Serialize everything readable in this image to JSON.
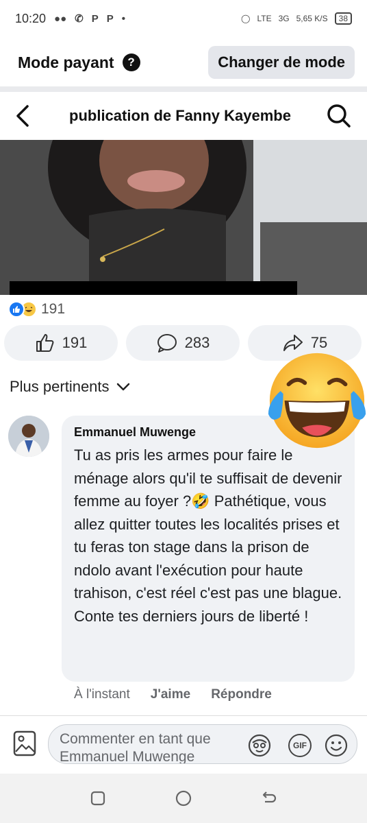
{
  "status": {
    "time": "10:20",
    "icons": [
      "game-icon",
      "whatsapp-icon",
      "p-icon",
      "p-icon",
      "dot"
    ],
    "network_lte": "LTE",
    "network_3g": "3G",
    "speed": "5,65",
    "speed_unit": "K/S",
    "battery": "38"
  },
  "mode": {
    "title": "Mode payant",
    "help_glyph": "?",
    "button_label": "Changer de mode"
  },
  "header": {
    "title": "publication de Fanny Kayembe"
  },
  "reactions": {
    "count": "191"
  },
  "actions": {
    "like_count": "191",
    "comment_count": "283",
    "share_count": "75"
  },
  "sort": {
    "label": "Plus pertinents"
  },
  "comment": {
    "author": "Emmanuel Muwenge",
    "text": "Tu as pris les armes pour faire le ménage alors qu'il te suffisait de devenir femme au foyer ?🤣 Pathétique, vous allez quitter toutes les localités prises et tu feras ton stage dans la prison de ndolo avant l'exécution pour haute trahison, c'est réel c'est pas une blague. Conte tes derniers jours de liberté !",
    "time": "À l'instant",
    "like_label": "J'aime",
    "reply_label": "Répondre"
  },
  "composer": {
    "placeholder": "Commenter en tant que Emmanuel Muwenge",
    "gif_label": "GIF"
  },
  "colors": {
    "facebook_blue": "#1877f2",
    "bubble_gray": "#f0f2f5",
    "haha_yellow": "#f7c745"
  }
}
